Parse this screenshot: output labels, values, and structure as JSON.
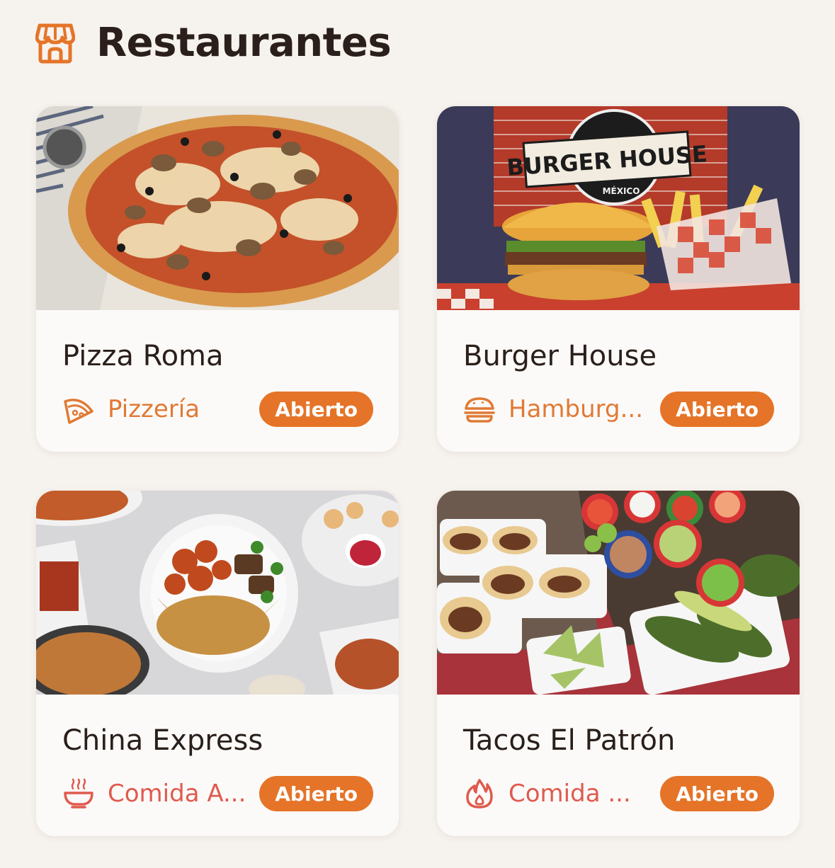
{
  "header": {
    "title": "Restaurantes",
    "icon": "store-icon"
  },
  "colors": {
    "accent": "#e57428",
    "category_orange": "#e07a34",
    "category_red": "#e05a4e",
    "text": "#2a1f1a"
  },
  "restaurants": [
    {
      "name": "Pizza Roma",
      "category": "Pizzería",
      "category_icon": "pizza-slice-icon",
      "status": "Abierto",
      "image": "pizza-photo"
    },
    {
      "name": "Burger House",
      "category": "Hamburg...",
      "category_icon": "burger-icon",
      "status": "Abierto",
      "image": "burger-house-photo"
    },
    {
      "name": "China Express",
      "category": "Comida A...",
      "category_icon": "bowl-icon",
      "status": "Abierto",
      "image": "chinese-food-photo"
    },
    {
      "name": "Tacos El Patrón",
      "category": "Comida ...",
      "category_icon": "flame-icon",
      "status": "Abierto",
      "image": "tacos-photo"
    }
  ],
  "images": {
    "burger_sign": {
      "title": "BURGER HOUSE",
      "subtitle": "MÉXICO"
    }
  }
}
